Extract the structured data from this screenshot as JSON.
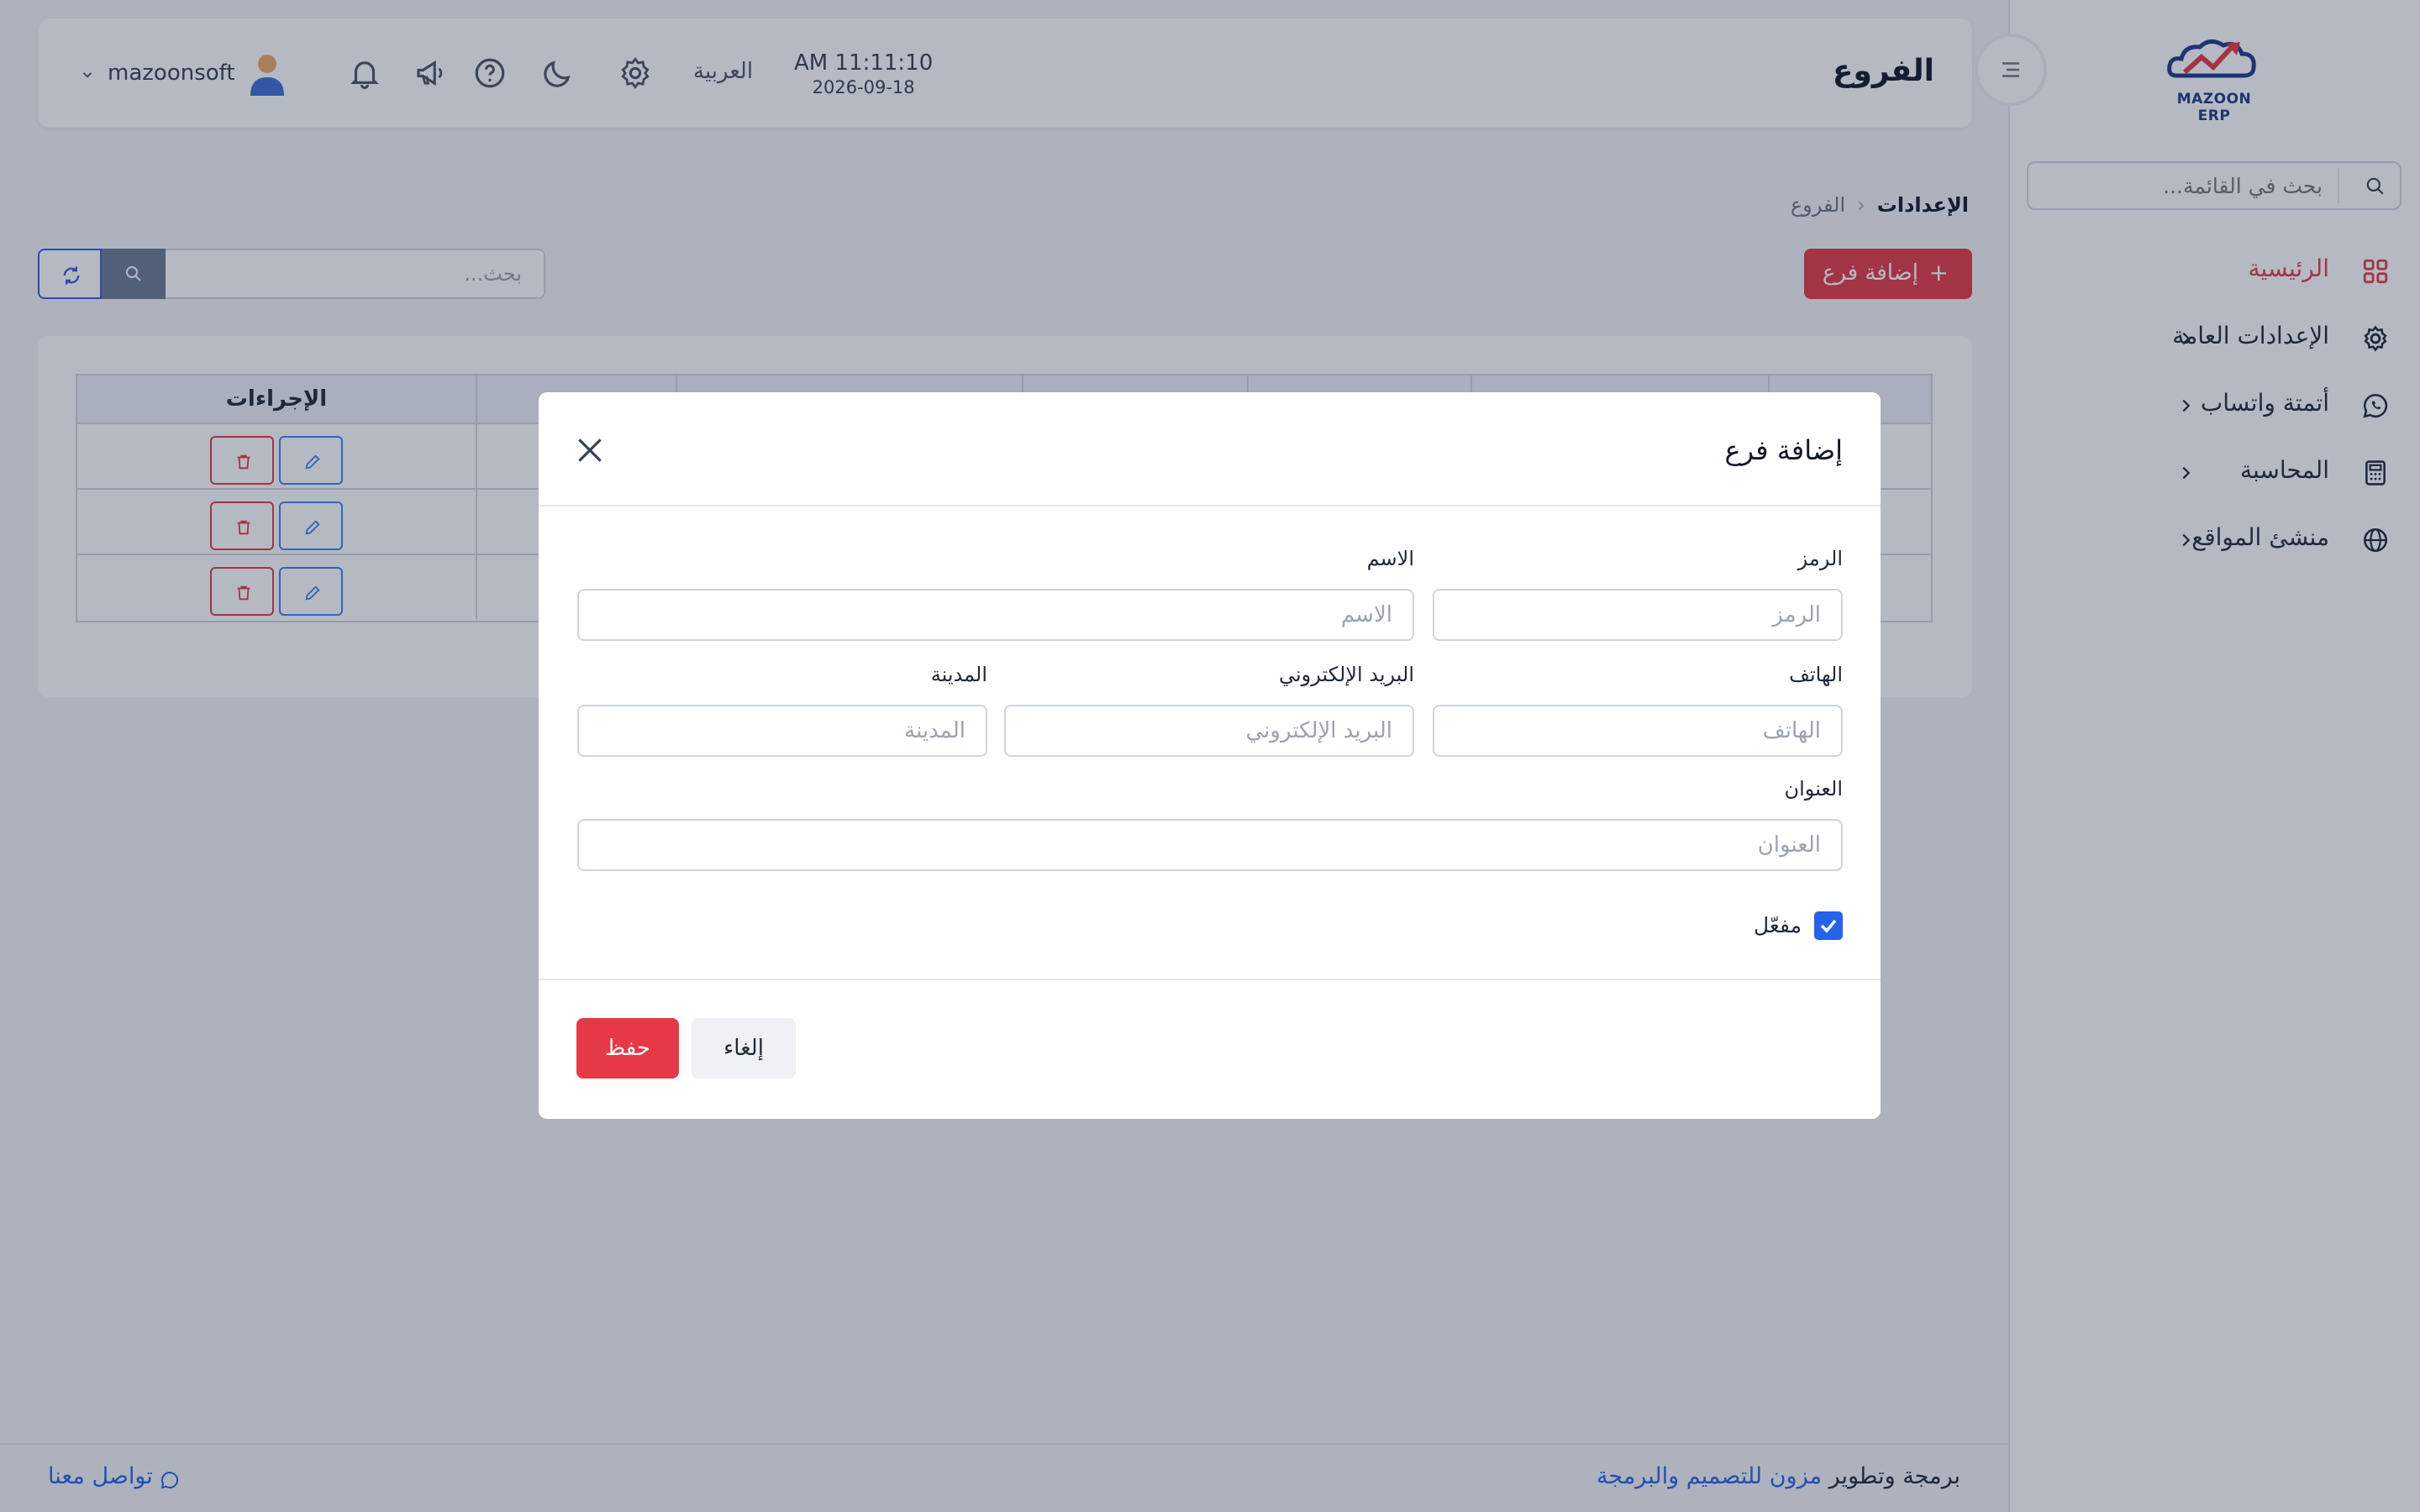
{
  "sidebar": {
    "logo_text": "MAZOON ERP",
    "search_placeholder": "بحث في القائمة...",
    "items": [
      {
        "label": "الرئيسية",
        "active": true,
        "icon": "grid-icon",
        "has_children": false
      },
      {
        "label": "الإعدادات العامة",
        "active": false,
        "icon": "gear-icon",
        "has_children": true
      },
      {
        "label": "أتمتة واتساب",
        "active": false,
        "icon": "whatsapp-icon",
        "has_children": true
      },
      {
        "label": "المحاسبة",
        "active": false,
        "icon": "calculator-icon",
        "has_children": true
      },
      {
        "label": "منشئ المواقع",
        "active": false,
        "icon": "globe-icon",
        "has_children": true
      }
    ]
  },
  "header": {
    "title": "الفروع",
    "time": "AM 11:11:10",
    "date": "2026-09-18",
    "language": "العربية",
    "user_name": "mazoonsoft",
    "icons": [
      "gear-icon",
      "moon-icon",
      "help-icon",
      "megaphone-icon",
      "bell-icon",
      "avatar",
      "chevron-down-icon",
      "menu-icon"
    ]
  },
  "breadcrumb": {
    "parent": "الإعدادات",
    "current": "الفروع"
  },
  "toolbar": {
    "add_label": "إضافة فرع",
    "search_placeholder": "بحث..."
  },
  "table": {
    "actions_header": "الإجراءات",
    "rows": 3
  },
  "modal": {
    "title": "إضافة فرع",
    "fields": {
      "code": {
        "label": "الرمز",
        "placeholder": "الرمز"
      },
      "name": {
        "label": "الاسم",
        "placeholder": "الاسم"
      },
      "phone": {
        "label": "الهاتف",
        "placeholder": "الهاتف"
      },
      "email": {
        "label": "البريد الإلكتروني",
        "placeholder": "البريد الإلكتروني"
      },
      "city": {
        "label": "المدينة",
        "placeholder": "المدينة"
      },
      "address": {
        "label": "العنوان",
        "placeholder": "العنوان"
      }
    },
    "active_label": "مفعّل",
    "active_checked": true,
    "save_label": "حفظ",
    "cancel_label": "إلغاء"
  },
  "footer": {
    "credit_prefix": "برمجة وتطوير",
    "credit_link": "مزون للتصميم والبرمجة",
    "contact": "تواصل معنا"
  },
  "colors": {
    "accent": "#e53945",
    "primary": "#2563eb",
    "overlay": "#1e2946"
  }
}
